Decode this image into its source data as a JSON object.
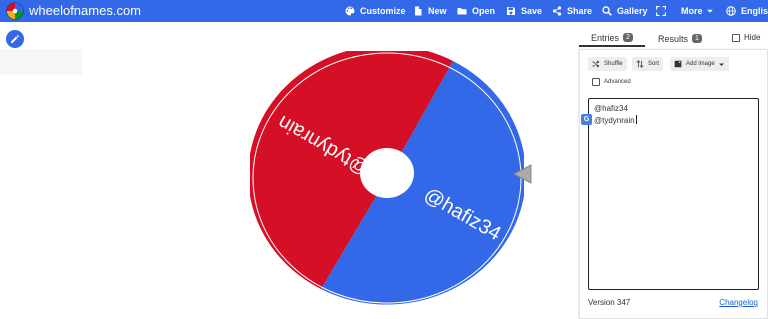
{
  "brand": {
    "name": "wheelofnames.com"
  },
  "nav": [
    {
      "label": "Customize",
      "icon": "palette-icon"
    },
    {
      "label": "New",
      "icon": "new-file-icon"
    },
    {
      "label": "Open",
      "icon": "folder-icon"
    },
    {
      "label": "Save",
      "icon": "save-icon"
    },
    {
      "label": "Share",
      "icon": "share-icon"
    },
    {
      "label": "Gallery",
      "icon": "search-icon"
    },
    {
      "label": "",
      "icon": "fullscreen-icon"
    },
    {
      "label": "More",
      "icon": "chevron-down-icon"
    },
    {
      "label": "English",
      "icon": "globe-icon"
    }
  ],
  "wheel": {
    "segments": [
      {
        "label": "@hafiz34",
        "color": "#3369e8"
      },
      {
        "label": "@tydynrain",
        "color": "#d50f25"
      }
    ],
    "hub_color": "#ffffff",
    "pointer_color": "#aaaaaa"
  },
  "panel": {
    "tabs": [
      {
        "label": "Entries",
        "count": "2",
        "active": true
      },
      {
        "label": "Results",
        "count": "1",
        "active": false
      }
    ],
    "hide_label": "Hide",
    "buttons": {
      "shuffle": "Shuffle",
      "sort": "Sort",
      "add_image": "Add image"
    },
    "advanced_label": "Advanced",
    "entries": [
      "@hafiz34",
      "@tydynrain"
    ],
    "version": "Version 347",
    "changelog": "Changelog"
  },
  "colors": {
    "topbar": "#3369e8",
    "accent": "#3369e8"
  }
}
